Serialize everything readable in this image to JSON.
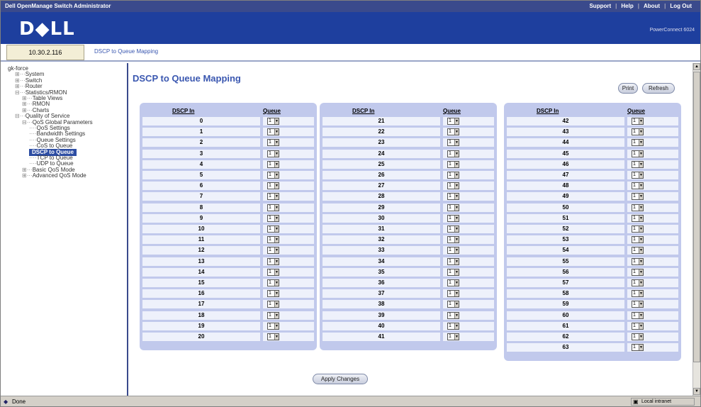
{
  "window": {
    "app_title": "Dell OpenManage Switch Administrator",
    "top_links": [
      "Support",
      "Help",
      "About",
      "Log Out"
    ]
  },
  "brand": {
    "logo": "D◆LL",
    "product": "PowerConnect 6024"
  },
  "header": {
    "ip": "10.30.2.116",
    "breadcrumb": "DSCP to Queue Mapping"
  },
  "sidebar": {
    "items": [
      {
        "label": "gk-force",
        "tw": "",
        "indent": 0
      },
      {
        "label": "System",
        "tw": "⊞···",
        "indent": 1
      },
      {
        "label": "Switch",
        "tw": "⊞···",
        "indent": 1
      },
      {
        "label": "Router",
        "tw": "⊞···",
        "indent": 1
      },
      {
        "label": "Statistics/RMON",
        "tw": "⊟···",
        "indent": 1
      },
      {
        "label": "Table Views",
        "tw": "⊞···",
        "indent": 2
      },
      {
        "label": "RMON",
        "tw": "⊞···",
        "indent": 2
      },
      {
        "label": "Charts",
        "tw": "⊞···",
        "indent": 2
      },
      {
        "label": "Quality of Service",
        "tw": "⊟···",
        "indent": 1
      },
      {
        "label": "QoS Global Parameters",
        "tw": "⊟···",
        "indent": 2
      },
      {
        "label": "QoS Settings",
        "tw": "····",
        "indent": 3
      },
      {
        "label": "Bandwidth Settings",
        "tw": "····",
        "indent": 3
      },
      {
        "label": "Queue Settings",
        "tw": "····",
        "indent": 3
      },
      {
        "label": "CoS to Queue",
        "tw": "····",
        "indent": 3
      },
      {
        "label": "DSCP to Queue",
        "tw": "",
        "indent": 3,
        "selected": true
      },
      {
        "label": "TCP to Queue",
        "tw": "····",
        "indent": 3
      },
      {
        "label": "UDP to Queue",
        "tw": "····",
        "indent": 3
      },
      {
        "label": "Basic QoS Mode",
        "tw": "⊞···",
        "indent": 2
      },
      {
        "label": "Advanced QoS Mode",
        "tw": "⊞···",
        "indent": 2
      }
    ]
  },
  "main": {
    "title": "DSCP to Queue Mapping",
    "print_label": "Print",
    "refresh_label": "Refresh",
    "apply_label": "Apply Changes",
    "col_dscp": "DSCP In",
    "col_queue": "Queue",
    "columns": [
      {
        "rows": [
          {
            "dscp": "0",
            "queue": "1"
          },
          {
            "dscp": "1",
            "queue": "1"
          },
          {
            "dscp": "2",
            "queue": "1"
          },
          {
            "dscp": "3",
            "queue": "1"
          },
          {
            "dscp": "4",
            "queue": "1"
          },
          {
            "dscp": "5",
            "queue": "1"
          },
          {
            "dscp": "6",
            "queue": "1"
          },
          {
            "dscp": "7",
            "queue": "1"
          },
          {
            "dscp": "8",
            "queue": "1"
          },
          {
            "dscp": "9",
            "queue": "1"
          },
          {
            "dscp": "10",
            "queue": "1"
          },
          {
            "dscp": "11",
            "queue": "1"
          },
          {
            "dscp": "12",
            "queue": "1"
          },
          {
            "dscp": "13",
            "queue": "1"
          },
          {
            "dscp": "14",
            "queue": "1"
          },
          {
            "dscp": "15",
            "queue": "1"
          },
          {
            "dscp": "16",
            "queue": "1"
          },
          {
            "dscp": "17",
            "queue": "1"
          },
          {
            "dscp": "18",
            "queue": "1"
          },
          {
            "dscp": "19",
            "queue": "1"
          },
          {
            "dscp": "20",
            "queue": "1"
          }
        ]
      },
      {
        "rows": [
          {
            "dscp": "21",
            "queue": "1"
          },
          {
            "dscp": "22",
            "queue": "1"
          },
          {
            "dscp": "23",
            "queue": "1"
          },
          {
            "dscp": "24",
            "queue": "1"
          },
          {
            "dscp": "25",
            "queue": "1"
          },
          {
            "dscp": "26",
            "queue": "1"
          },
          {
            "dscp": "27",
            "queue": "1"
          },
          {
            "dscp": "28",
            "queue": "1"
          },
          {
            "dscp": "29",
            "queue": "1"
          },
          {
            "dscp": "30",
            "queue": "1"
          },
          {
            "dscp": "31",
            "queue": "1"
          },
          {
            "dscp": "32",
            "queue": "1"
          },
          {
            "dscp": "33",
            "queue": "1"
          },
          {
            "dscp": "34",
            "queue": "1"
          },
          {
            "dscp": "35",
            "queue": "1"
          },
          {
            "dscp": "36",
            "queue": "1"
          },
          {
            "dscp": "37",
            "queue": "1"
          },
          {
            "dscp": "38",
            "queue": "1"
          },
          {
            "dscp": "39",
            "queue": "1"
          },
          {
            "dscp": "40",
            "queue": "1"
          },
          {
            "dscp": "41",
            "queue": "1"
          }
        ]
      },
      {
        "rows": [
          {
            "dscp": "42",
            "queue": "1"
          },
          {
            "dscp": "43",
            "queue": "1"
          },
          {
            "dscp": "44",
            "queue": "1"
          },
          {
            "dscp": "45",
            "queue": "1"
          },
          {
            "dscp": "46",
            "queue": "1"
          },
          {
            "dscp": "47",
            "queue": "1"
          },
          {
            "dscp": "48",
            "queue": "1"
          },
          {
            "dscp": "49",
            "queue": "1"
          },
          {
            "dscp": "50",
            "queue": "1"
          },
          {
            "dscp": "51",
            "queue": "1"
          },
          {
            "dscp": "52",
            "queue": "1"
          },
          {
            "dscp": "53",
            "queue": "1"
          },
          {
            "dscp": "54",
            "queue": "1"
          },
          {
            "dscp": "55",
            "queue": "1"
          },
          {
            "dscp": "56",
            "queue": "1"
          },
          {
            "dscp": "57",
            "queue": "1"
          },
          {
            "dscp": "58",
            "queue": "1"
          },
          {
            "dscp": "59",
            "queue": "1"
          },
          {
            "dscp": "60",
            "queue": "1"
          },
          {
            "dscp": "61",
            "queue": "1"
          },
          {
            "dscp": "62",
            "queue": "1"
          },
          {
            "dscp": "63",
            "queue": "1"
          }
        ]
      }
    ]
  },
  "status": {
    "text": "Done",
    "zone": "Local intranet"
  },
  "colors": {
    "title_bar": "#3a4a8c",
    "brand_bar": "#1e3f9e",
    "panel": "#c1c9ec",
    "link": "#3a57b0"
  },
  "icons": {
    "status": "ie-page-icon",
    "zone": "intranet-icon"
  }
}
